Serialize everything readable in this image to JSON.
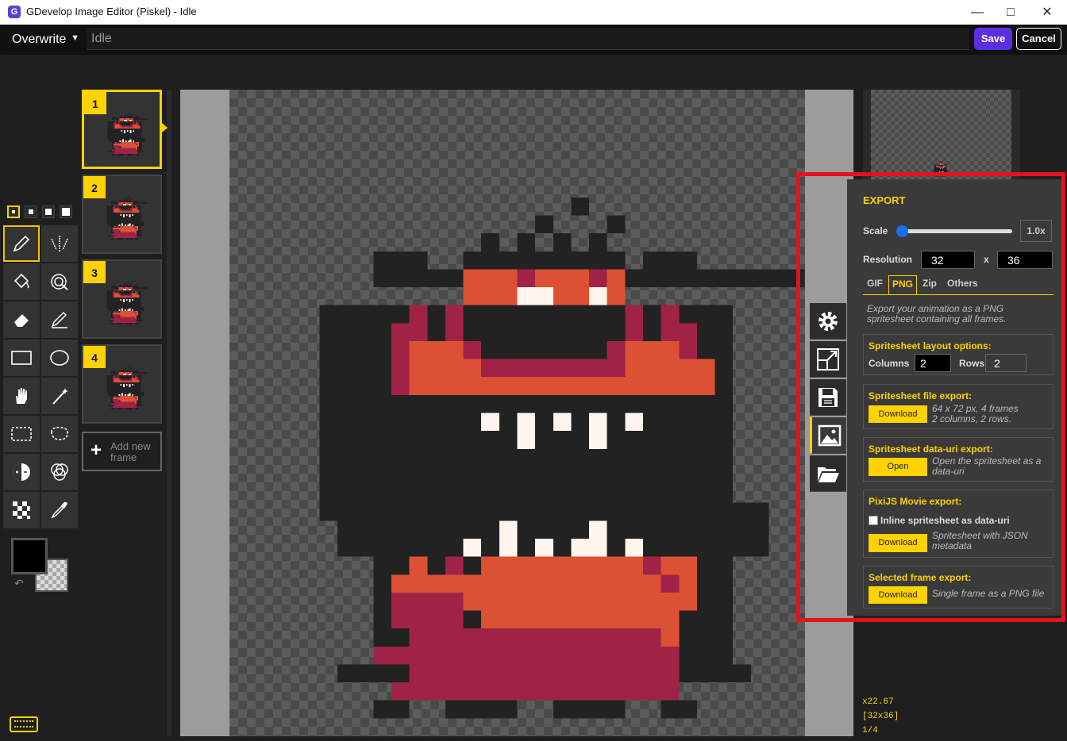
{
  "window": {
    "title": "GDevelop Image Editor (Piskel) - Idle",
    "icon": "G"
  },
  "toolbar": {
    "mode": "Overwrite",
    "name_value": "Idle",
    "save_label": "Save",
    "cancel_label": "Cancel"
  },
  "frames": [
    {
      "number": "1"
    },
    {
      "number": "2"
    },
    {
      "number": "3"
    },
    {
      "number": "4"
    }
  ],
  "add_frame": {
    "line1": "Add new",
    "line2": "frame"
  },
  "export": {
    "heading": "EXPORT",
    "scale_label": "Scale",
    "scale_value": "1.0x",
    "resolution_label": "Resolution",
    "res_width": "32",
    "res_x": "x",
    "res_height": "36",
    "tabs": [
      "GIF",
      "PNG",
      "Zip",
      "Others"
    ],
    "active_tab": "PNG",
    "description": "Export your animation as a PNG spritesheet containing all frames.",
    "layout": {
      "title": "Spritesheet layout options:",
      "columns_label": "Columns",
      "columns": "2",
      "rows_label": "Rows",
      "rows": "2"
    },
    "file_export": {
      "title": "Spritesheet file export:",
      "button": "Download",
      "info_line1": "64 x 72 px, 4 frames",
      "info_line2": "2 columns, 2 rows."
    },
    "datauri_export": {
      "title": "Spritesheet data-uri export:",
      "button": "Open",
      "info_line1": "Open the spritesheet as a",
      "info_line2": "data-uri"
    },
    "pixi_export": {
      "title": "PixiJS Movie export:",
      "checkbox_label": "Inline spritesheet as data-uri",
      "button": "Download",
      "info_line1": "Spritesheet with JSON",
      "info_line2": "metadata"
    },
    "frame_export": {
      "title": "Selected frame export:",
      "button": "Download",
      "info": "Single frame as a PNG file"
    }
  },
  "status": {
    "zoom": "x22.67",
    "size": "[32x36]",
    "frame": "1/4"
  },
  "colors": {
    "accent": "#ffd200",
    "primary_button": "#5b2fe0",
    "highlight_outline": "#e0141e"
  }
}
